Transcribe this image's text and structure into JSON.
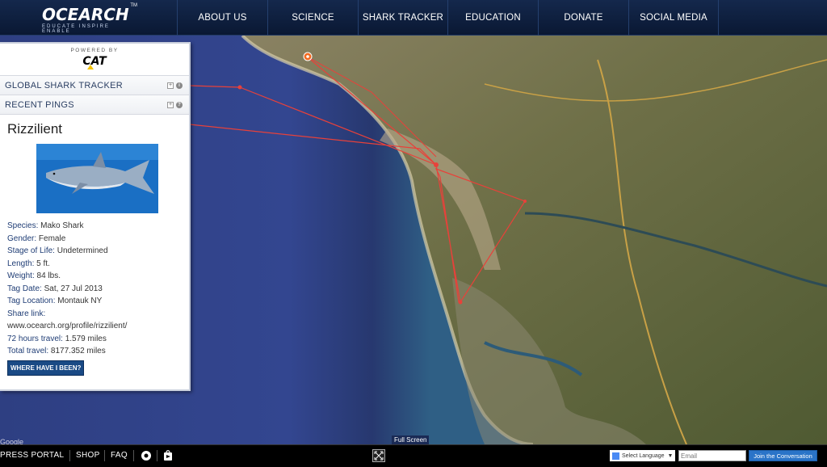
{
  "header": {
    "logo_text": "OCEARCH",
    "logo_tagline": "EDUCATE   INSPIRE   ENABLE",
    "logo_tm": "TM",
    "nav": [
      {
        "label": "ABOUT US"
      },
      {
        "label": "SCIENCE"
      },
      {
        "label": "SHARK TRACKER"
      },
      {
        "label": "EDUCATION"
      },
      {
        "label": "DONATE"
      },
      {
        "label": "SOCIAL MEDIA"
      }
    ]
  },
  "panel": {
    "powered_by": "POWERED BY",
    "sponsor_logo": "CAT",
    "sections": [
      {
        "label": "GLOBAL SHARK TRACKER"
      },
      {
        "label": "RECENT PINGS"
      }
    ],
    "profile": {
      "name": "Rizzilient",
      "fields": [
        {
          "key": "Species:",
          "value": "Mako Shark"
        },
        {
          "key": "Gender:",
          "value": "Female"
        },
        {
          "key": "Stage of Life:",
          "value": "Undetermined"
        },
        {
          "key": "Length:",
          "value": "5 ft."
        },
        {
          "key": "Weight:",
          "value": "84 lbs."
        },
        {
          "key": "Tag Date:",
          "value": "Sat, 27 Jul 2013"
        },
        {
          "key": "Tag Location:",
          "value": "Montauk NY"
        },
        {
          "key": "Share link:",
          "value": "www.ocearch.org/profile/rizzilient/"
        },
        {
          "key": "72 hours travel:",
          "value": "1.579 miles"
        },
        {
          "key": "Total travel:",
          "value": "8177.352 miles"
        }
      ],
      "button": "WHERE HAVE I BEEN?"
    }
  },
  "map": {
    "fullscreen_label": "Full Screen",
    "google_label": "Google",
    "track_color": "#e8413a",
    "marker_color": "#f26b21"
  },
  "footer": {
    "links": [
      {
        "label": "PRESS PORTAL"
      },
      {
        "label": "SHOP"
      },
      {
        "label": "FAQ"
      }
    ],
    "language": "Select Language",
    "email_placeholder": "Email",
    "join_button": "Join the Conversation"
  }
}
